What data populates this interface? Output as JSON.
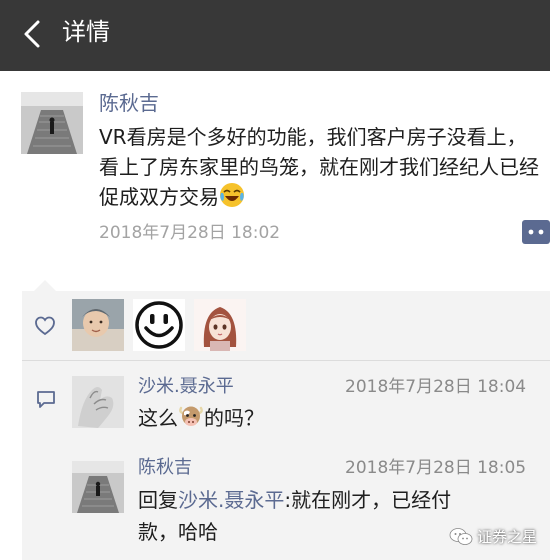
{
  "nav": {
    "title": "详情",
    "back_icon": "chevron-left-icon"
  },
  "post": {
    "author": "陈秋吉",
    "text": "VR看房是个多好的功能，我们客户房子没看上，看上了房东家里的鸟笼，就在刚才我们经纪人已经促成双方交易",
    "emoji": "laughing-tears-emoji",
    "time": "2018年7月28日 18:02"
  },
  "interactions": {
    "likes_icon": "heart-outline-icon",
    "liker_avatars": [
      "baby-photo-avatar",
      "smiley-face-avatar",
      "anime-girl-avatar"
    ],
    "comments_icon": "comment-bubble-icon",
    "comments": [
      {
        "name": "沙米.聂永平",
        "time": "2018年7月28日 18:04",
        "text_before": "这么",
        "emoji": "cow-emoji",
        "text_after": "的吗？"
      },
      {
        "name": "陈秋吉",
        "time": "2018年7月28日 18:05",
        "reply_prefix": "回复",
        "reply_to": "沙米.聂永平",
        "text": ":就在刚才，已经付款，哈哈"
      }
    ]
  },
  "watermark": {
    "text": "证券之星"
  },
  "colors": {
    "nav_bg": "#383838",
    "name_blue": "#5b6a91",
    "panel_bg": "#f3f3f3",
    "time_gray": "#a3a3a3"
  }
}
